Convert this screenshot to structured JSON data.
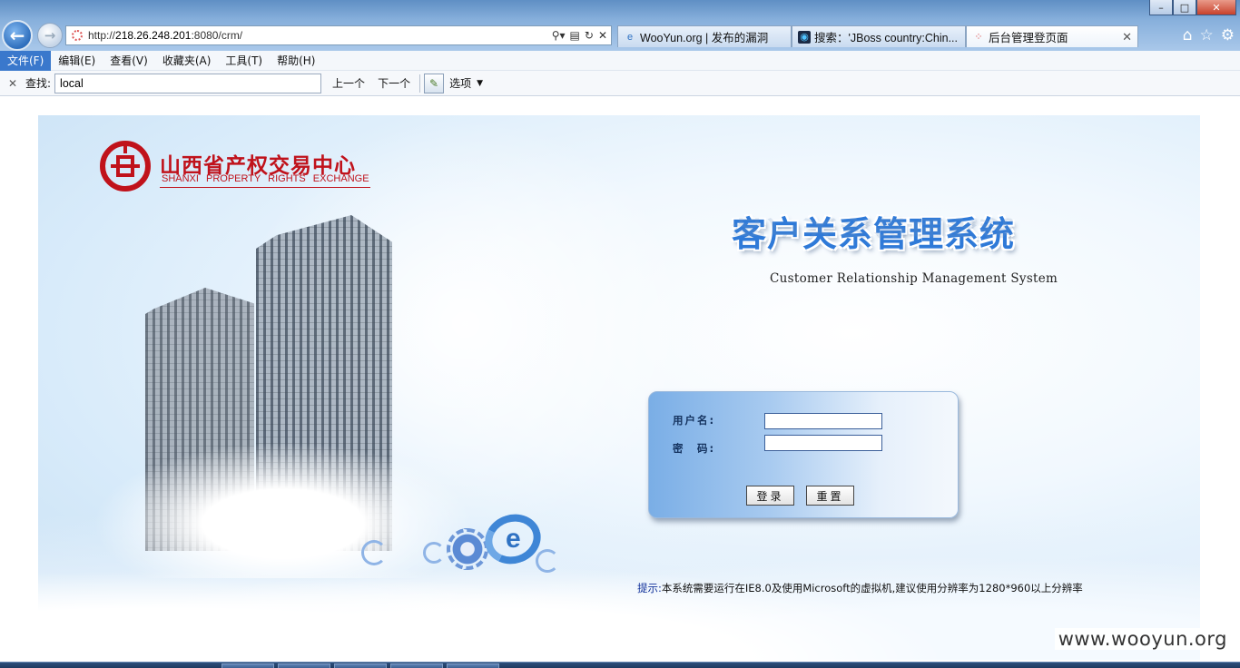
{
  "browser": {
    "url_prefix": "http://",
    "url_host": "218.26.248.201",
    "url_path": ":8080/crm/",
    "tabs": [
      {
        "label": "WooYun.org | 发布的漏洞",
        "icon": "ie-icon",
        "active": false
      },
      {
        "label": "搜索：'JBoss country:Chin...",
        "icon": "search-engine-icon",
        "active": false
      },
      {
        "label": "后台管理登页面",
        "icon": "loading-icon",
        "active": true
      }
    ],
    "window_controls": {
      "minimize": "–",
      "maximize": "□",
      "close": "✕"
    }
  },
  "menu": {
    "items": [
      "文件(F)",
      "编辑(E)",
      "查看(V)",
      "收藏夹(A)",
      "工具(T)",
      "帮助(H)"
    ]
  },
  "findbar": {
    "close": "✕",
    "label": "查找:",
    "value": "local",
    "prev": "上一个",
    "next": "下一个",
    "options": "选项"
  },
  "page": {
    "logo_cn": "山西省产权交易中心",
    "logo_en": "SHANXI PROPERTY RIGHTS EXCHANGE",
    "system_title": "客户关系管理系统",
    "system_subtitle": "Customer Relationship Management System",
    "login": {
      "username_label": "用户名:",
      "password_label": "密　码:",
      "username_value": "",
      "password_value": "",
      "login_button": "登录",
      "reset_button": "重置"
    },
    "tip_label": "提示:",
    "tip_text": "本系统需要运行在IE8.0及使用Microsoft的虚拟机,建议使用分辨率为1280*960以上分辨率"
  },
  "watermark": "www.wooyun.org",
  "colors": {
    "logo_red": "#c0121b",
    "title_blue": "#2f7ad8",
    "menu_active": "#3a78cc"
  }
}
